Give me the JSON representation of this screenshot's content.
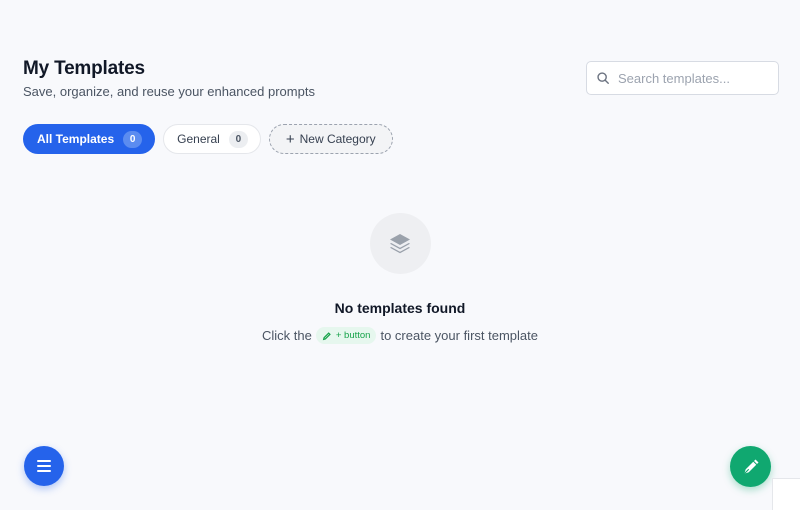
{
  "header": {
    "title": "My Templates",
    "subtitle": "Save, organize, and reuse your enhanced prompts"
  },
  "search": {
    "placeholder": "Search templates...",
    "value": "",
    "icon": "search-icon"
  },
  "tabs": [
    {
      "label": "All Templates",
      "count": "0",
      "active": true
    },
    {
      "label": "General",
      "count": "0",
      "active": false
    }
  ],
  "new_category": {
    "label": "New Category",
    "icon": "plus-icon"
  },
  "empty_state": {
    "icon": "layers-icon",
    "title": "No templates found",
    "hint_before": "Click the",
    "chip_label": "+ button",
    "hint_after": "to create your first template"
  },
  "fabs": {
    "menu_icon": "menu-icon",
    "create_icon": "pen-icon"
  },
  "colors": {
    "accent": "#2563eb",
    "success": "#10a870",
    "background": "#f8f9fc"
  }
}
